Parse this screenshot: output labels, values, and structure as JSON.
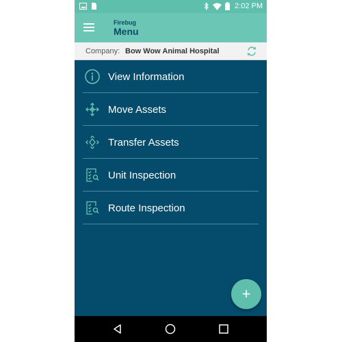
{
  "status_bar": {
    "time": "2:02 PM",
    "icons": [
      "image-icon",
      "sim-card-icon",
      "bluetooth-icon",
      "wifi-icon",
      "battery-icon"
    ]
  },
  "app_bar": {
    "subtitle": "Firebug",
    "title": "Menu",
    "menu_icon": "hamburger-icon"
  },
  "company": {
    "label": "Company:",
    "name": "Bow Wow Animal Hospital",
    "refresh_icon": "refresh-icon"
  },
  "menu": {
    "items": [
      {
        "label": "View Information",
        "icon": "info-icon"
      },
      {
        "label": "Move Assets",
        "icon": "move-icon"
      },
      {
        "label": "Transfer Assets",
        "icon": "transfer-icon"
      },
      {
        "label": "Unit Inspection",
        "icon": "inspection-icon"
      },
      {
        "label": "Route Inspection",
        "icon": "inspection-icon"
      }
    ]
  },
  "fab": {
    "label": "+"
  },
  "nav_bar": {
    "buttons": [
      "back-icon",
      "home-icon",
      "recents-icon"
    ]
  },
  "colors": {
    "primary_teal": "#6cc6b6",
    "status_teal": "#5dbfac",
    "menu_background": "#054b6c",
    "title_text": "#0d4a66",
    "divider": "#4a8aa1"
  }
}
